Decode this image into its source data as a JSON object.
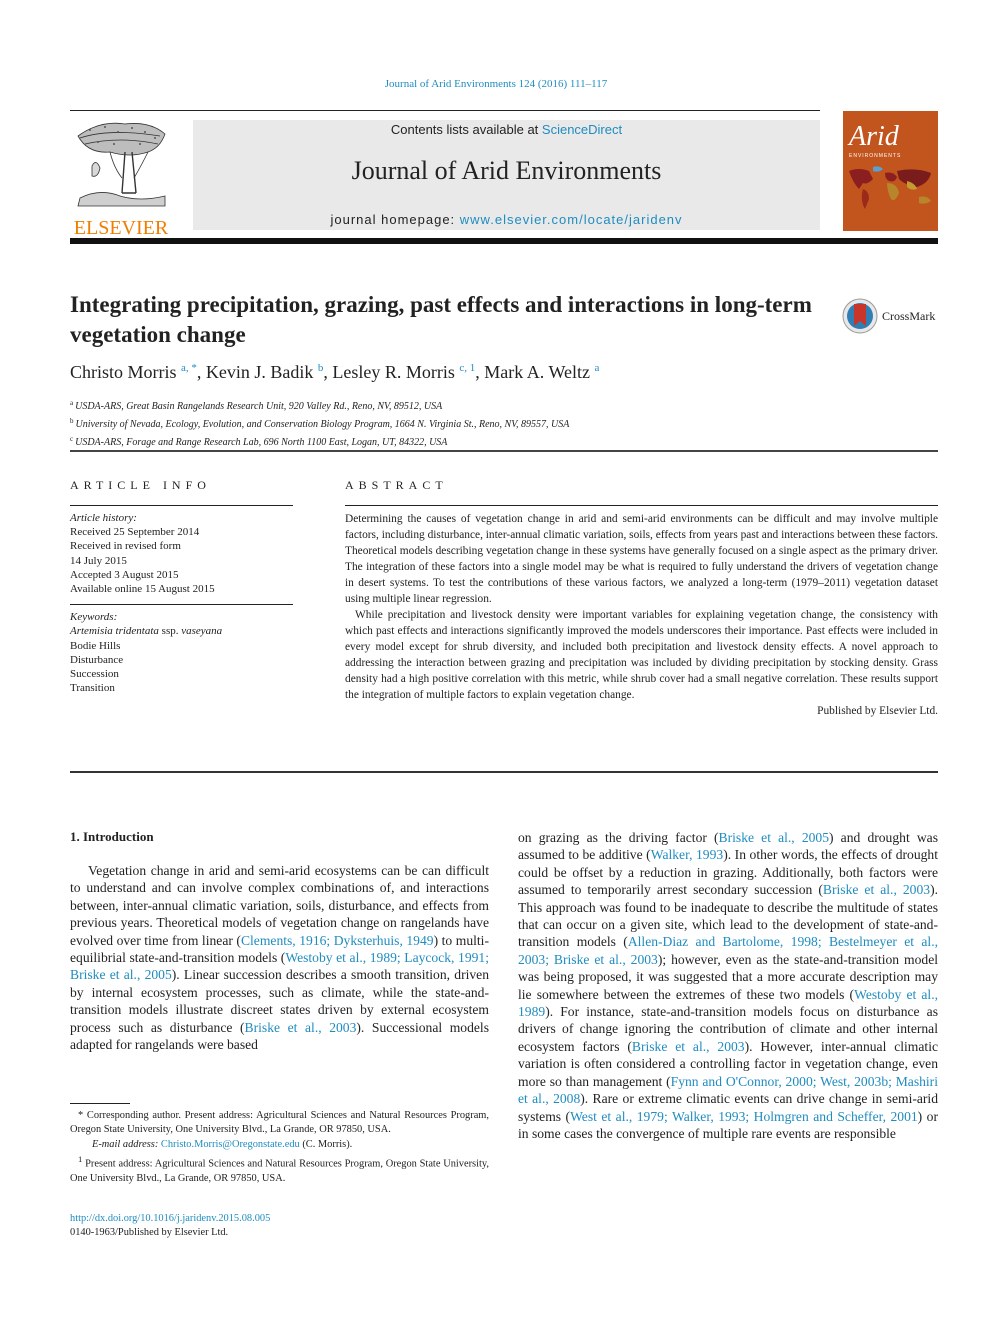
{
  "header": {
    "citation": "Journal of Arid Environments 124 (2016) 111–117",
    "contents_prefix": "Contents lists available at ",
    "contents_link": "ScienceDirect",
    "journal_name": "Journal of Arid Environments",
    "homepage_prefix": "journal homepage: ",
    "homepage_link": "www.elsevier.com/locate/jaridenv",
    "publisher_logo_text": "ELSEVIER",
    "cover_title": "Arid",
    "cover_subtitle": "ENVIRONMENTS",
    "colors": {
      "link": "#1f8cc0",
      "elsevier_orange": "#f07d00",
      "cover_background": "#c2541e",
      "masthead_background": "#e9e9e9"
    }
  },
  "article": {
    "title": "Integrating precipitation, grazing, past effects and interactions in long-term vegetation change",
    "crossmark_label": "CrossMark",
    "authors": [
      {
        "name": "Christo Morris",
        "sup": "a, *",
        "sep": ", "
      },
      {
        "name": "Kevin J. Badik",
        "sup": "b",
        "sep": ", "
      },
      {
        "name": "Lesley R. Morris",
        "sup": "c, 1",
        "sep": ", "
      },
      {
        "name": "Mark A. Weltz",
        "sup": "a",
        "sep": ""
      }
    ],
    "affiliations": [
      {
        "key": "a",
        "text": "USDA-ARS, Great Basin Rangelands Research Unit, 920 Valley Rd., Reno, NV, 89512, USA"
      },
      {
        "key": "b",
        "text": "University of Nevada, Ecology, Evolution, and Conservation Biology Program, 1664 N. Virginia St., Reno, NV, 89557, USA"
      },
      {
        "key": "c",
        "text": "USDA-ARS, Forage and Range Research Lab, 696 North 1100 East, Logan, UT, 84322, USA"
      }
    ]
  },
  "article_info": {
    "heading": "ARTICLE INFO",
    "history_label": "Article history:",
    "history": [
      "Received 25 September 2014",
      "Received in revised form",
      "14 July 2015",
      "Accepted 3 August 2015",
      "Available online 15 August 2015"
    ],
    "keywords_label": "Keywords:",
    "keywords_first_italic": "Artemisia tridentata",
    "keywords_first_plain": " ssp. ",
    "keywords_first_italic2": "vaseyana",
    "keywords": [
      "Bodie Hills",
      "Disturbance",
      "Succession",
      "Transition"
    ]
  },
  "abstract": {
    "heading": "ABSTRACT",
    "paragraphs": [
      "Determining the causes of vegetation change in arid and semi-arid environments can be difficult and may involve multiple factors, including disturbance, inter-annual climatic variation, soils, effects from years past and interactions between these factors. Theoretical models describing vegetation change in these systems have generally focused on a single aspect as the primary driver. The integration of these factors into a single model may be what is required to fully understand the drivers of vegetation change in desert systems. To test the contributions of these various factors, we analyzed a long-term (1979–2011) vegetation dataset using multiple linear regression.",
      "While precipitation and livestock density were important variables for explaining vegetation change, the consistency with which past effects and interactions significantly improved the models underscores their importance. Past effects were included in every model except for shrub diversity, and included both precipitation and livestock density effects. A novel approach to addressing the interaction between grazing and precipitation was included by dividing precipitation by stocking density. Grass density had a high positive correlation with this metric, while shrub cover had a small negative correlation. These results support the integration of multiple factors to explain vegetation change."
    ],
    "publisher_note": "Published by Elsevier Ltd."
  },
  "introduction": {
    "heading": "1.  Introduction",
    "left_segments": [
      {
        "t": "Vegetation change in arid and semi-arid ecosystems can be can difficult to understand and can involve complex combinations of, and interactions between, inter-annual climatic variation, soils, disturbance, and effects from previous years. Theoretical models of vegetation change on rangelands have evolved over time from linear ("
      },
      {
        "l": "Clements, 1916; Dyksterhuis, 1949"
      },
      {
        "t": ") to multi-equilibrial state-and-transition models ("
      },
      {
        "l": "Westoby et al., 1989; Laycock, 1991; Briske et al., 2005"
      },
      {
        "t": "). Linear succession describes a smooth transition, driven by internal ecosystem processes, such as climate, while the state-and-transition models illustrate discreet states driven by external ecosystem process such as disturbance ("
      },
      {
        "l": "Briske et al., 2003"
      },
      {
        "t": "). Successional models adapted for rangelands were based"
      }
    ],
    "right_segments": [
      {
        "t": "on grazing as the driving factor ("
      },
      {
        "l": "Briske et al., 2005"
      },
      {
        "t": ") and drought was assumed to be additive ("
      },
      {
        "l": "Walker, 1993"
      },
      {
        "t": "). In other words, the effects of drought could be offset by a reduction in grazing. Additionally, both factors were assumed to temporarily arrest secondary succession ("
      },
      {
        "l": "Briske et al., 2003"
      },
      {
        "t": "). This approach was found to be inadequate to describe the multitude of states that can occur on a given site, which lead to the development of state-and-transition models ("
      },
      {
        "l": "Allen-Diaz and Bartolome, 1998; Bestelmeyer et al., 2003; Briske et al., 2003"
      },
      {
        "t": "); however, even as the state-and-transition model was being proposed, it was suggested that a more accurate description may lie somewhere between the extremes of these two models ("
      },
      {
        "l": "Westoby et al., 1989"
      },
      {
        "t": "). For instance, state-and-transition models focus on disturbance as drivers of change ignoring the contribution of climate and other internal ecosystem factors ("
      },
      {
        "l": "Briske et al., 2003"
      },
      {
        "t": "). However, inter-annual climatic variation is often considered a controlling factor in vegetation change, even more so than management ("
      },
      {
        "l": "Fynn and O'Connor, 2000; West, 2003b; Mashiri et al., 2008"
      },
      {
        "t": "). Rare or extreme climatic events can drive change in semi-arid systems ("
      },
      {
        "l": "West et al., 1979; Walker, 1993; Holmgren and Scheffer, 2001"
      },
      {
        "t": ") or in some cases the convergence of multiple rare events are responsible"
      }
    ]
  },
  "footnotes": {
    "corresponding_marker": "*",
    "corresponding_text": "Corresponding author. Present address: Agricultural Sciences and Natural Resources Program, Oregon State University, One University Blvd., La Grande, OR 97850, USA.",
    "email_label": "E-mail address:",
    "email": "Christo.Morris@Oregonstate.edu",
    "email_suffix": " (C. Morris).",
    "note1_marker": "1",
    "note1_text": "Present address: Agricultural Sciences and Natural Resources Program, Oregon State University, One University Blvd., La Grande, OR 97850, USA."
  },
  "doi": {
    "link": "http://dx.doi.org/10.1016/j.jaridenv.2015.08.005",
    "issn_line": "0140-1963/Published by Elsevier Ltd."
  }
}
